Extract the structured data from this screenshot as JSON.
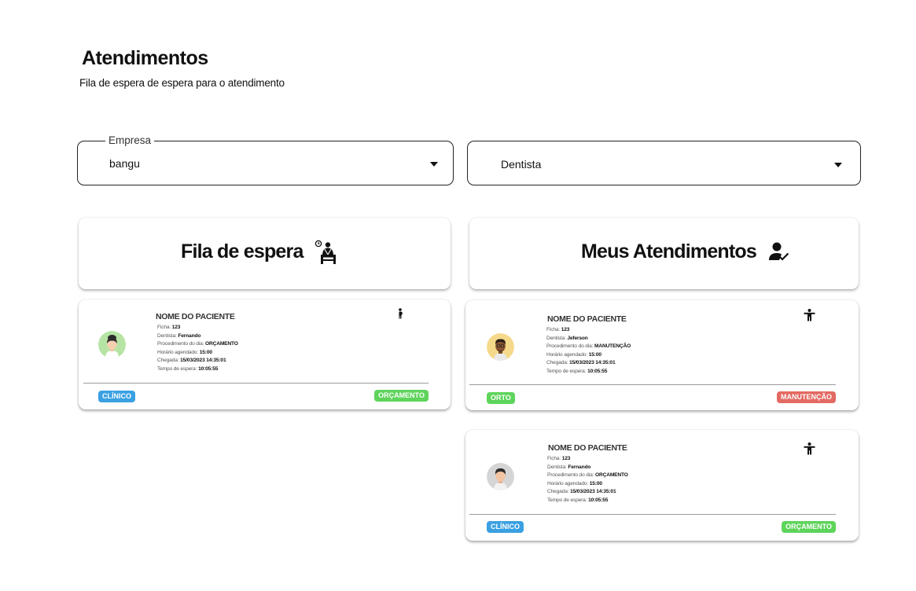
{
  "page": {
    "title": "Atendimentos",
    "subtitle": "Fila de espera de espera para o atendimento"
  },
  "filters": {
    "empresa": {
      "label": "Empresa",
      "value": "bangu"
    },
    "especialidade": {
      "value": "Dentista"
    }
  },
  "sections": {
    "queue_title": "Fila de espera",
    "mine_title": "Meus Atendimentos"
  },
  "field_labels": {
    "ficha": "Ficha:",
    "dentista": "Dentista:",
    "procedimento": "Procedimento do dia:",
    "horario": "Horário agendado:",
    "chegada": "Chegada:",
    "tempo": "Tempo de espera:"
  },
  "queue": [
    {
      "name": "NOME DO PACIENTE",
      "ficha": "123",
      "dentista": "Fernando",
      "procedimento": "ORÇAMENTO",
      "horario": "15:00",
      "chegada": "15/03/2023 14:35:01",
      "tempo": "10:05:55",
      "tag_left": "CLÍNICO",
      "tag_right": "ORÇAMENTO",
      "icon": "pregnant-person-icon"
    }
  ],
  "mine": [
    {
      "name": "NOME DO PACIENTE",
      "ficha": "123",
      "dentista": "Jeferson",
      "procedimento": "MANUTENÇÃO",
      "horario": "15:00",
      "chegada": "15/03/2023 14:35:01",
      "tempo": "10:05:55",
      "tag_left": "ORTO",
      "tag_right": "MANUTENÇÃO",
      "icon": "accessibility-person-icon"
    },
    {
      "name": "NOME DO PACIENTE",
      "ficha": "123",
      "dentista": "Fernando",
      "procedimento": "ORÇAMENTO",
      "horario": "15:00",
      "chegada": "15/03/2023 14:35:01",
      "tempo": "10:05:55",
      "tag_left": "CLÍNICO",
      "tag_right": "ORÇAMENTO",
      "icon": "accessibility-person-icon"
    }
  ],
  "colors": {
    "tag_blue": "#3aa0e2",
    "tag_green": "#5ed45b",
    "tag_red": "#e36a63"
  }
}
